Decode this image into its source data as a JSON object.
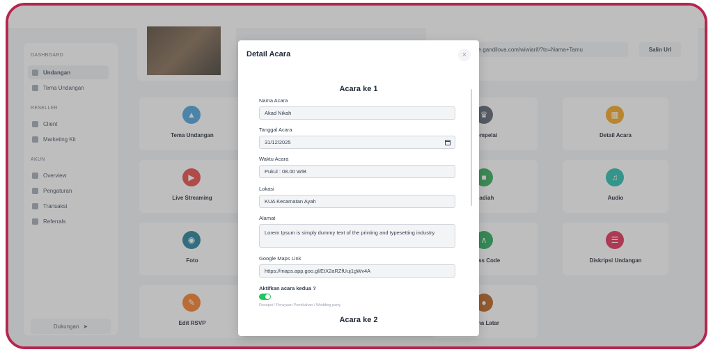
{
  "frame_color": "#b5264f",
  "sidebar": {
    "sections": [
      {
        "title": "DASHBOARD",
        "items": [
          {
            "label": "Undangan",
            "icon": "invitation-icon",
            "active": true
          },
          {
            "label": "Tema Undangan",
            "icon": "theme-icon"
          }
        ]
      },
      {
        "title": "RESELLER",
        "items": [
          {
            "label": "Client",
            "icon": "dollar-icon"
          },
          {
            "label": "Marketing Kit",
            "icon": "users-icon"
          }
        ]
      },
      {
        "title": "AKUN",
        "items": [
          {
            "label": "Overview",
            "icon": "overview-icon"
          },
          {
            "label": "Pengaturan",
            "icon": "settings-icon"
          },
          {
            "label": "Transaksi",
            "icon": "transaction-icon"
          },
          {
            "label": "Referrals",
            "icon": "referral-icon"
          }
        ]
      }
    ],
    "support_label": "Dukungan"
  },
  "share": {
    "url": "the.gandilova.com/wiwiarif/?to=Nama+Tamu",
    "copy_label": "Salin Url"
  },
  "tiles": [
    {
      "label": "Tema Undangan",
      "icon": "shirt-icon",
      "color": "#3b9ad9"
    },
    {
      "label": "Mempelai",
      "icon": "crown-icon",
      "color": "#4b5563"
    },
    {
      "label": "Detail Acara",
      "icon": "calendar-icon",
      "color": "#f59e0b"
    },
    {
      "label": "Live Streaming",
      "icon": "live-icon",
      "color": "#e53935"
    },
    {
      "label": "Hadiah",
      "icon": "gift-icon",
      "color": "#22a34a"
    },
    {
      "label": "Audio",
      "icon": "headphones-icon",
      "color": "#14b8a6"
    },
    {
      "label": "Foto",
      "icon": "camera-icon",
      "color": "#0e7490"
    },
    {
      "label": "Dress Code",
      "icon": "hanger-icon",
      "color": "#16a34a"
    },
    {
      "label": "Diskripsi Undangan",
      "icon": "document-icon",
      "color": "#e11d48"
    },
    {
      "label": "Edit RSVP",
      "icon": "pencil-icon",
      "color": "#f97316"
    },
    {
      "label": "Tema Latar",
      "icon": "palette-icon",
      "color": "#b45309"
    }
  ],
  "modal": {
    "title": "Detail Acara",
    "event1_heading": "Acara ke 1",
    "event2_heading": "Acara ke 2",
    "fields": {
      "nama_label": "Nama Acara",
      "nama_value": "Akad Nikah",
      "tanggal_label": "Tanggal Acara",
      "tanggal_value": "31/12/2025",
      "waktu_label": "Waktu Acara",
      "waktu_value": "Pukul : 08.00 WIB",
      "lokasi_label": "Lokasi",
      "lokasi_value": "KUA Kecamatan Ayah",
      "alamat_label": "Alamat",
      "alamat_value": "Lorem Ipsum is simply dummy text of the printing and typesetting industry",
      "maps_label": "Google Maps Link",
      "maps_value": "https://maps.app.goo.gl/EtX2aRZfUuj1gWv4A"
    },
    "toggle_label": "Aktifkan acara kedua ?",
    "toggle_on": true,
    "toggle_hint": "Resepsi / Perayaan Pernikahan / Wedding party"
  }
}
